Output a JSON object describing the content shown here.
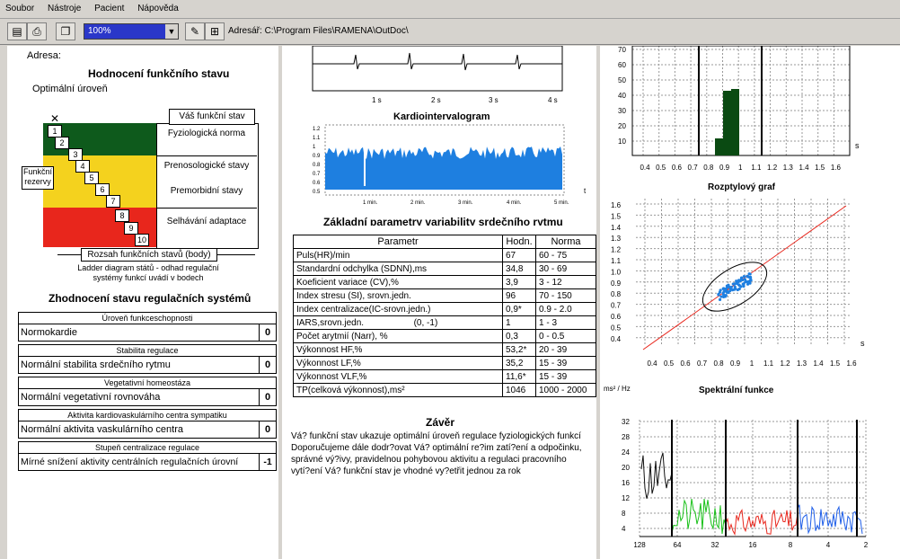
{
  "menu": [
    "Soubor",
    "Nástroje",
    "Pacient",
    "Nápověda"
  ],
  "toolbar": {
    "zoom": "100%",
    "path": "Adresář: C:\\Program Files\\RAMENA\\OutDoc\\"
  },
  "left": {
    "address_label": "Adresa:",
    "title": "Hodnocení funkčního stavu",
    "subtitle": "Optimální úroveň",
    "ladder_numbers": [
      "1",
      "2",
      "3",
      "4",
      "5",
      "6",
      "7",
      "8",
      "9",
      "10"
    ],
    "your_state": "Váš funkční stav",
    "zone_labels": [
      "Fyziologická norma",
      "Prenosologické stavy",
      "Premorbidní stavy",
      "Selhávání adaptace"
    ],
    "reserve_label": "Funkční rezervy",
    "range_label": "Rozsah funkčních stavů (body)",
    "caption": "Ladder diagram států - odhad regulační systémy funkcí uvádí v bodech",
    "section_title": "Zhodnocení stavu regulačních systémů",
    "reg": [
      {
        "header": "Úroveň funkceschopnosti",
        "value": "Normokardie",
        "score": "0"
      },
      {
        "header": "Stabilita regulace",
        "value": "Normální stabilita srdečního rytmu",
        "score": "0"
      },
      {
        "header": "Vegetativní homeostáza",
        "value": "Normální vegetativní rovnováha",
        "score": "0"
      },
      {
        "header": "Aktivita kardiovaskulárního centra sympatiku",
        "value": "Normální aktivita vaskulárního centra",
        "score": "0"
      },
      {
        "header": "Stupeň centralizace regulace",
        "value": "Mírné snížení aktivity centrálních regulačních úrovní",
        "score": "-1"
      }
    ]
  },
  "middle": {
    "ecg_ticks": [
      "1 s",
      "2 s",
      "3 s",
      "4 s"
    ],
    "kig_title": "Kardiointervalogram",
    "kig_yticks": [
      "1.2",
      "1.1",
      "1",
      "0.9",
      "0.8",
      "0.7",
      "0.6",
      "0.5"
    ],
    "kig_xticks": [
      "1 min.",
      "2 min.",
      "3 min.",
      "4 min.",
      "5 min."
    ],
    "kig_unit": "t",
    "table_title": "Základní parametry variability srdečního rytmu",
    "table_headers": [
      "Parametr",
      "Hodn.",
      "Norma"
    ],
    "rows": [
      [
        "Puls(HR)/min",
        "67",
        "60 - 75"
      ],
      [
        "Standardní odchylka (SDNN),ms",
        "34,8",
        "30 - 69"
      ],
      [
        "Koeficient variace (CV),%",
        "3,9",
        "3 - 12"
      ],
      [
        "Index stresu (SI), srovn.jedn.",
        "96",
        "70 - 150"
      ],
      [
        "Index centralizace(IC-srovn.jedn.)",
        "0,9*",
        "0.9 - 2.0"
      ],
      [
        "IARS,srovn.jedn.                    (0, -1)",
        "1",
        "1 - 3"
      ],
      [
        "Počet arytmií (Narr), %",
        "0,3",
        "0 - 0.5"
      ],
      [
        "Výkonnost HF,%",
        "53,2*",
        "20 - 39"
      ],
      [
        "Výkonnost LF,%",
        "35,2",
        "15 - 39"
      ],
      [
        "Výkonnost VLF,%",
        "11,6*",
        "15 - 39"
      ],
      [
        "TP(celková výkonnost),ms²",
        "1046",
        "1000 - 2000"
      ]
    ],
    "conclusion_title": "Závěr",
    "conclusion": "Vá? funkční stav ukazuje optimální úroveň regulace fyziologických funkcí Doporučujeme dále dodr?ovat Vá? optimální re?im zatí?ení a odpočinku, správné vý?ivy, pravidelnou pohybovou aktivitu a regulaci pracovního vytí?ení Vá? funkční stav je vhodné vy?etřit jednou za rok"
  },
  "right": {
    "hist_yticks": [
      "70",
      "60",
      "50",
      "40",
      "30",
      "20",
      "10"
    ],
    "xticks": [
      "0.4",
      "0.5",
      "0.6",
      "0.7",
      "0.8",
      "0.9",
      "1",
      "1.1",
      "1.2",
      "1.3",
      "1.4",
      "1.5",
      "1.6"
    ],
    "unit_s": "s",
    "scatter_title": "Rozptylový graf",
    "scatter_yticks": [
      "1.6",
      "1.5",
      "1.4",
      "1.3",
      "1.2",
      "1.1",
      "1.0",
      "0.9",
      "0.8",
      "0.7",
      "0.6",
      "0.5",
      "0.4"
    ],
    "spec_title": "Spektrální funkce",
    "spec_unit": "ms² / Hz",
    "spec_yticks": [
      "32",
      "28",
      "24",
      "20",
      "16",
      "12",
      "8",
      "4"
    ],
    "spec_xticks": [
      "128",
      "64",
      "32",
      "16",
      "8",
      "4",
      "2"
    ],
    "colors": {
      "kig": "#1e7fe0",
      "hist": "#0a4a12",
      "green": "#0e5a1c",
      "yellow": "#f4d21e",
      "red": "#e8261c",
      "hf": "#1e5ee8",
      "lf": "#e8261c",
      "vlf": "#18c018"
    }
  }
}
